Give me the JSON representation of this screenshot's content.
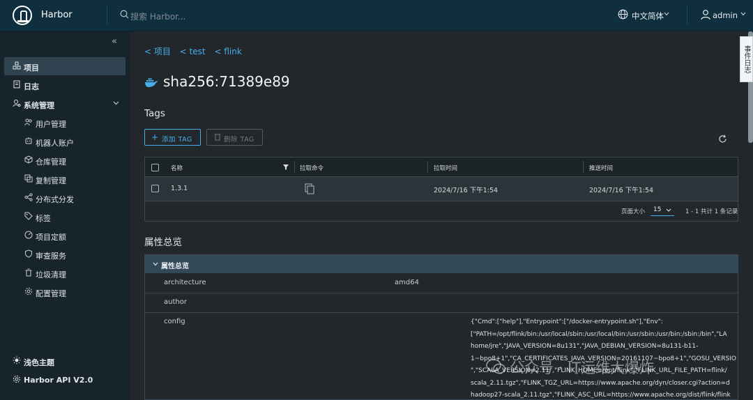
{
  "header": {
    "app_name": "Harbor",
    "search_placeholder": "搜索 Harbor...",
    "language": "中文简体",
    "user": "admin"
  },
  "sidebar": {
    "items": [
      {
        "label": "项目",
        "icon": "projects-icon",
        "active": true
      },
      {
        "label": "日志",
        "icon": "logs-icon"
      },
      {
        "label": "系统管理",
        "icon": "admin-icon",
        "expanded": true
      }
    ],
    "sub_items": [
      {
        "label": "用户管理",
        "icon": "users-icon"
      },
      {
        "label": "机器人账户",
        "icon": "robot-icon"
      },
      {
        "label": "仓库管理",
        "icon": "registry-icon"
      },
      {
        "label": "复制管理",
        "icon": "replication-icon"
      },
      {
        "label": "分布式分发",
        "icon": "share-icon"
      },
      {
        "label": "标签",
        "icon": "tag-icon"
      },
      {
        "label": "项目定额",
        "icon": "quota-icon"
      },
      {
        "label": "审查服务",
        "icon": "shield-icon"
      },
      {
        "label": "垃圾清理",
        "icon": "trash-icon"
      },
      {
        "label": "配置管理",
        "icon": "gear-icon"
      }
    ],
    "theme_label": "浅色主题",
    "api_label": "Harbor API V2.0"
  },
  "breadcrumb": [
    "< 项目",
    "< test",
    "< flink"
  ],
  "page_title": "sha256:71389e89",
  "tags_section": {
    "heading": "Tags",
    "add_button": "添加 TAG",
    "delete_button": "删除 TAG",
    "columns": [
      "名称",
      "拉取命令",
      "拉取时间",
      "推送时间"
    ],
    "rows": [
      {
        "name": "1.3.1",
        "pull_time": "2024/7/16 下午1:54",
        "push_time": "2024/7/16 下午1:54"
      }
    ],
    "page_size_label": "页面大小",
    "page_size": "15",
    "pagination_text": "1 - 1 共计 1 条记录"
  },
  "properties": {
    "heading": "属性总览",
    "panel_title": "属性总览",
    "rows": [
      {
        "key": "architecture",
        "value": "amd64"
      },
      {
        "key": "author",
        "value": ""
      },
      {
        "key": "config",
        "value": ""
      }
    ],
    "config_lines": [
      "{\"Cmd\":[\"help\"],\"Entrypoint\":[\"/docker-entrypoint.sh\"],\"Env\":",
      "[\"PATH=/opt/flink/bin:/usr/local/sbin:/usr/local/bin:/usr/sbin:/usr/bin:/sbin:/bin\",\"LA",
      "home/jre\",\"JAVA_VERSION=8u131\",\"JAVA_DEBIAN_VERSION=8u131-b11-",
      "1~bpo8+1\",\"CA_CERTIFICATES_JAVA_VERSION=20161107~bpo8+1\",\"GOSU_VERSIO",
      "\",\"SCALA_VERSION=2.11\",\"FLINK_HOME=/opt/flink\",\"FLINK_URL_FILE_PATH=flink/",
      "scala_2.11.tgz\",\"FLINK_TGZ_URL=https://www.apache.org/dyn/closer.cgi?action=d",
      "hadoop27-scala_2.11.tgz\",\"FLINK_ASC_URL=https://www.apache.org/dist/flink/flink"
    ]
  },
  "event_tab": "事件日志",
  "watermark": "公众号 · IT运维大爆炸",
  "colors": {
    "accent": "#49aeea",
    "header_bg": "#0f2f3f",
    "sidebar_bg": "#17242b",
    "main_bg": "#21272b"
  }
}
